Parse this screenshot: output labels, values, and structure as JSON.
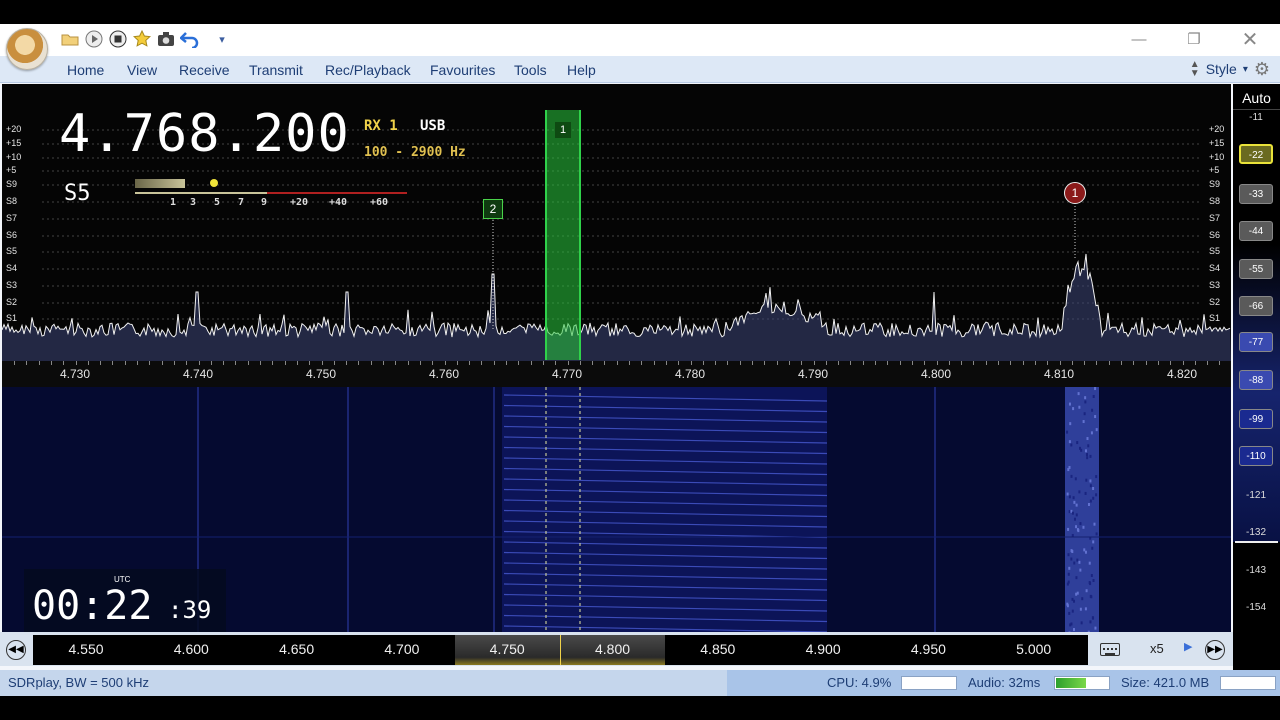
{
  "menu": {
    "items": [
      "Home",
      "View",
      "Receive",
      "Transmit",
      "Rec/Playback",
      "Favourites",
      "Tools",
      "Help"
    ],
    "style_label": "Style"
  },
  "receiver": {
    "frequency": "4.768.200",
    "rx_label": "RX 1",
    "mode": "USB",
    "bandwidth": "100 - 2900 Hz",
    "signal": "S5",
    "meter_scale": [
      "1",
      "3",
      "5",
      "7",
      "9",
      "+20",
      "+40",
      "+60"
    ]
  },
  "spectrum": {
    "left_scale": [
      "+20",
      "+15",
      "+10",
      "+5",
      "S9",
      "S8",
      "S7",
      "S6",
      "S5",
      "S4",
      "S3",
      "S2",
      "S1"
    ],
    "right_scale": [
      "+20",
      "+15",
      "+10",
      "+5",
      "S9",
      "S8",
      "S7",
      "S6",
      "S5",
      "S4",
      "S3",
      "S2",
      "S1"
    ],
    "freq_axis": [
      "4.730",
      "4.740",
      "4.750",
      "4.760",
      "4.770",
      "4.780",
      "4.790",
      "4.800",
      "4.810",
      "4.820"
    ],
    "markers": {
      "vfo": "1",
      "marker2": "2",
      "marker1": "1"
    }
  },
  "clock": {
    "utc_label": "UTC",
    "time": "00:22",
    "seconds": ":39"
  },
  "dbscale": {
    "auto_label": "Auto",
    "values": [
      "-11",
      "-22",
      "-33",
      "-44",
      "-55",
      "-66",
      "-77",
      "-88",
      "-99",
      "-110",
      "-121",
      "-132",
      "-143",
      "-154"
    ],
    "active": "-22"
  },
  "overview": {
    "labels": [
      "4.550",
      "4.600",
      "4.650",
      "4.700",
      "4.750",
      "4.800",
      "4.850",
      "4.900",
      "4.950",
      "5.000"
    ],
    "zoom": "x5"
  },
  "status": {
    "device": "SDRplay, BW = 500 kHz",
    "cpu": "CPU: 4.9%",
    "audio": "Audio: 32ms",
    "size": "Size: 421.0 MB"
  },
  "colors": {
    "accent": "#1e3e75",
    "vfo_green": "#2fd24a",
    "marker_red": "#8b1a1a",
    "waterfall_bg": "#050a30"
  }
}
